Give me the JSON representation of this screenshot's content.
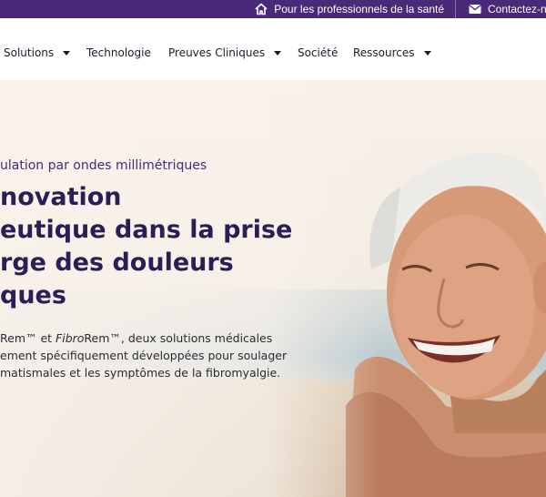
{
  "topbar": {
    "professionals_label": "Pour les professionnels de la santé",
    "contact_label": "Contactez-nous",
    "home_icon": "home-icon",
    "mail_icon": "envelope-icon"
  },
  "nav": {
    "items": [
      {
        "label": "Solutions",
        "dropdown": true
      },
      {
        "label": "Technologie",
        "dropdown": false
      },
      {
        "label": "Preuves Cliniques",
        "dropdown": true
      },
      {
        "label": "Société",
        "dropdown": false
      },
      {
        "label": "Ressources",
        "dropdown": true
      }
    ]
  },
  "hero": {
    "eyebrow": "ulation par ondes millimétriques",
    "headline_lines": [
      "novation",
      "eutique dans la prise",
      "rge des douleurs",
      "ques"
    ],
    "body": {
      "line1_prefix": "Rem™ et ",
      "line1_italic": "Fibro",
      "line1_suffix": "Rem™, deux solutions médicales",
      "line2": "ement spécifiquement développées pour soulager",
      "line3": "matismales et les symptômes de la fibromyalgie."
    }
  },
  "colors": {
    "topbar_bg": "#4a2a78",
    "headline": "#2a1e55",
    "eyebrow": "#4a2a78"
  }
}
